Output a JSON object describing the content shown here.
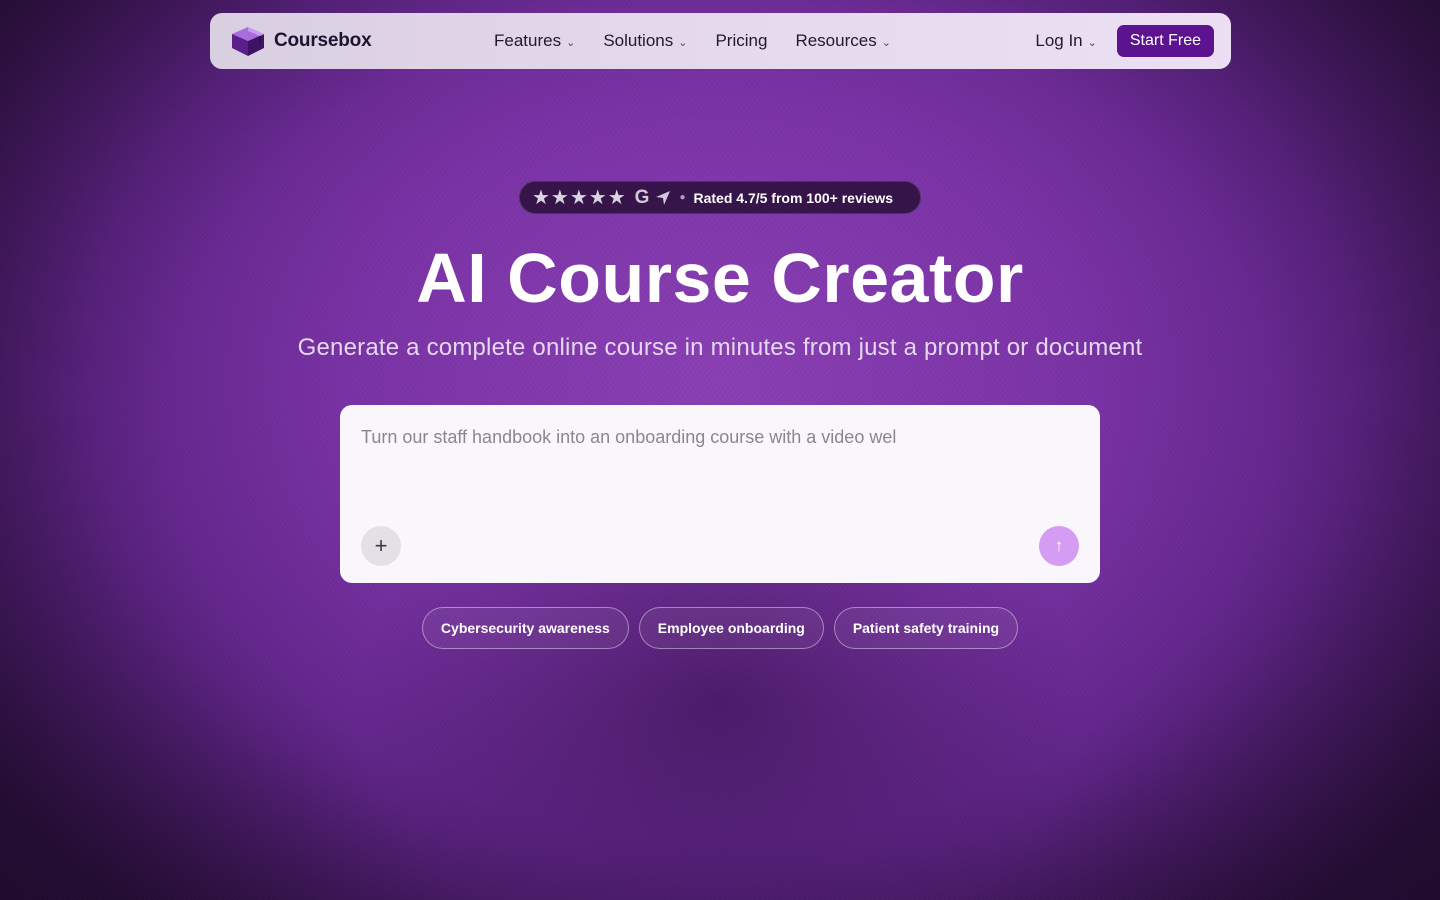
{
  "brand": {
    "name": "Coursebox",
    "accent": "#5d1390"
  },
  "nav": {
    "items": [
      {
        "label": "Features",
        "dropdown": true
      },
      {
        "label": "Solutions",
        "dropdown": true
      },
      {
        "label": "Pricing",
        "dropdown": false
      },
      {
        "label": "Resources",
        "dropdown": true
      }
    ],
    "login_label": "Log In",
    "cta_label": "Start Free"
  },
  "rating": {
    "stars": 5,
    "star_glyphs": "★★★★★",
    "google_glyph": "G",
    "text": "Rated 4.7/5 from 100+ reviews",
    "icons": [
      "star-icon",
      "google-icon",
      "capterra-icon"
    ]
  },
  "hero": {
    "title": "AI Course Creator",
    "subtitle": "Generate a complete online course in minutes from just a prompt or document"
  },
  "prompt": {
    "placeholder": "Turn our staff handbook into an onboarding course with a video wel",
    "value": "",
    "add_glyph": "+",
    "send_glyph": "↑",
    "send_color": "#d59cf3"
  },
  "suggestions": [
    "Cybersecurity awareness",
    "Employee onboarding",
    "Patient safety training"
  ]
}
